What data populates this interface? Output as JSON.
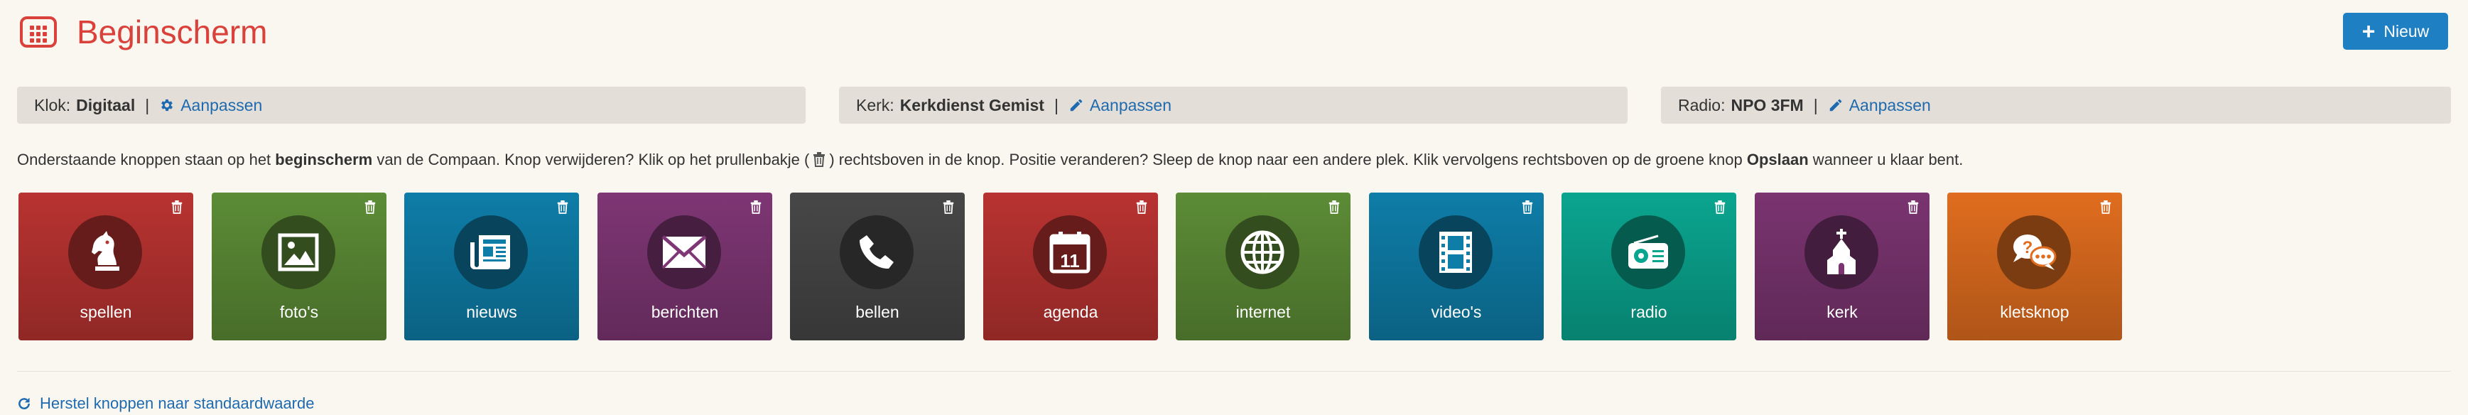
{
  "header": {
    "title": "Beginscherm",
    "new_label": "Nieuw"
  },
  "settings": {
    "clock": {
      "label": "Klok:",
      "value": "Digitaal",
      "sep": "|",
      "action": "Aanpassen"
    },
    "church": {
      "label": "Kerk:",
      "value": "Kerkdienst Gemist",
      "sep": "|",
      "action": "Aanpassen"
    },
    "radio": {
      "label": "Radio:",
      "value": "NPO 3FM",
      "sep": "|",
      "action": "Aanpassen"
    }
  },
  "instruction": {
    "part1": "Onderstaande knoppen staan op het ",
    "bold1": "beginscherm",
    "part2": " van de Compaan. Knop verwijderen? Klik op het prullenbakje (",
    "part3": ") rechtsboven in de knop. Positie veranderen? Sleep de knop naar een andere plek. Klik vervolgens rechtsboven op de groene knop ",
    "bold2": "Opslaan",
    "part4": " wanneer u klaar bent."
  },
  "tiles": [
    {
      "label": "spellen",
      "icon": "chess-knight-icon",
      "color": "#b83331"
    },
    {
      "label": "foto's",
      "icon": "photo-icon",
      "color": "#5c8c36"
    },
    {
      "label": "nieuws",
      "icon": "newspaper-icon",
      "color": "#0e7da8"
    },
    {
      "label": "berichten",
      "icon": "envelope-icon",
      "color": "#7e3674"
    },
    {
      "label": "bellen",
      "icon": "phone-icon",
      "color": "#474747"
    },
    {
      "label": "agenda",
      "icon": "calendar-icon",
      "color": "#b83331"
    },
    {
      "label": "internet",
      "icon": "globe-icon",
      "color": "#5c8c36"
    },
    {
      "label": "video's",
      "icon": "film-icon",
      "color": "#0e7da8"
    },
    {
      "label": "radio",
      "icon": "radio-icon",
      "color": "#0aa58f"
    },
    {
      "label": "kerk",
      "icon": "church-icon",
      "color": "#7a3470"
    },
    {
      "label": "kletsknop",
      "icon": "chat-icon",
      "color": "#e06d1f"
    }
  ],
  "calendar_day": "11",
  "reset": {
    "label": "Herstel knoppen naar standaardwaarde"
  }
}
